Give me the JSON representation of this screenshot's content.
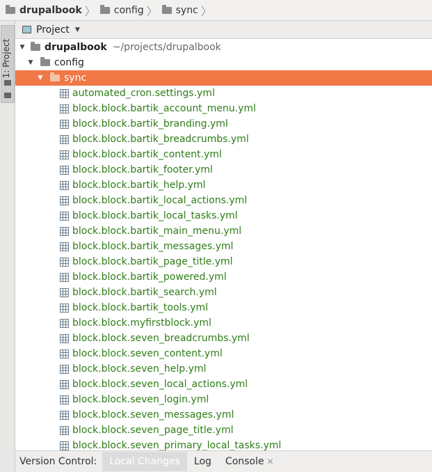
{
  "breadcrumb": [
    "drupalbook",
    "config",
    "sync"
  ],
  "sidebar": {
    "tab_label": "1: Project"
  },
  "project_panel": {
    "title": "Project"
  },
  "tree": {
    "root": {
      "name": "drupalbook",
      "path": "~/projects/drupalbook"
    },
    "folders": [
      "config",
      "sync"
    ],
    "files": [
      "automated_cron.settings.yml",
      "block.block.bartik_account_menu.yml",
      "block.block.bartik_branding.yml",
      "block.block.bartik_breadcrumbs.yml",
      "block.block.bartik_content.yml",
      "block.block.bartik_footer.yml",
      "block.block.bartik_help.yml",
      "block.block.bartik_local_actions.yml",
      "block.block.bartik_local_tasks.yml",
      "block.block.bartik_main_menu.yml",
      "block.block.bartik_messages.yml",
      "block.block.bartik_page_title.yml",
      "block.block.bartik_powered.yml",
      "block.block.bartik_search.yml",
      "block.block.bartik_tools.yml",
      "block.block.myfirstblock.yml",
      "block.block.seven_breadcrumbs.yml",
      "block.block.seven_content.yml",
      "block.block.seven_help.yml",
      "block.block.seven_local_actions.yml",
      "block.block.seven_login.yml",
      "block.block.seven_messages.yml",
      "block.block.seven_page_title.yml",
      "block.block.seven_primary_local_tasks.yml"
    ]
  },
  "bottom_bar": {
    "label": "Version Control:",
    "tabs": [
      "Local Changes",
      "Log",
      "Console"
    ]
  },
  "colors": {
    "selection": "#f07746",
    "file_text": "#2e7d17"
  }
}
